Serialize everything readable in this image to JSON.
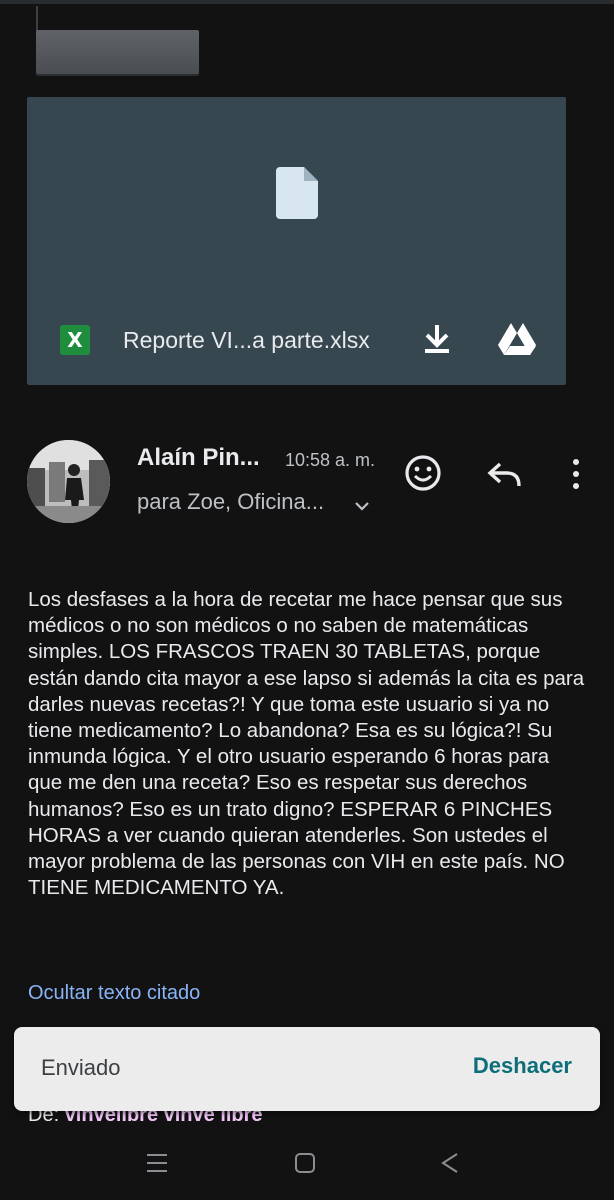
{
  "attachment": {
    "badge": "X",
    "file_name": "Reporte VI...a parte.xlsx",
    "download_icon": "download-icon",
    "drive_icon": "google-drive-icon",
    "file_icon": "file-icon"
  },
  "message": {
    "sender": "Alaín Pin...",
    "time": "10:58 a. m.",
    "recipients": "para Zoe, Oficina...",
    "body": "Los desfases a la hora de recetar me hace pensar que sus médicos o no son médicos o no saben de matemáticas simples. LOS FRASCOS TRAEN 30 TABLETAS, porque están dando cita mayor a ese lapso si además la cita es para darles nuevas recetas?! Y que toma este usuario si ya no tiene medicamento? Lo abandona? Esa es su lógica?! Su inmunda lógica. Y el otro usuario esperando 6 horas para que me den una receta? Eso es respetar sus derechos humanos? Eso es un trato digno? ESPERAR 6 PINCHES HORAS a ver cuando quieran atenderles. Son ustedes el mayor problema de las personas con VIH en este país. NO TIENE MEDICAMENTO YA.",
    "quoted_toggle": "Ocultar texto citado",
    "quoted_from_label": "De:",
    "quoted_sender": "vihvelibre vihve libre"
  },
  "snackbar": {
    "message": "Enviado",
    "action": "Deshacer"
  },
  "colors": {
    "background": "#121212",
    "attachment_card": "#37474f",
    "link": "#8ab4f8",
    "snackbar_action": "#0b6e78",
    "xlsx_green": "#1e8e3e"
  }
}
